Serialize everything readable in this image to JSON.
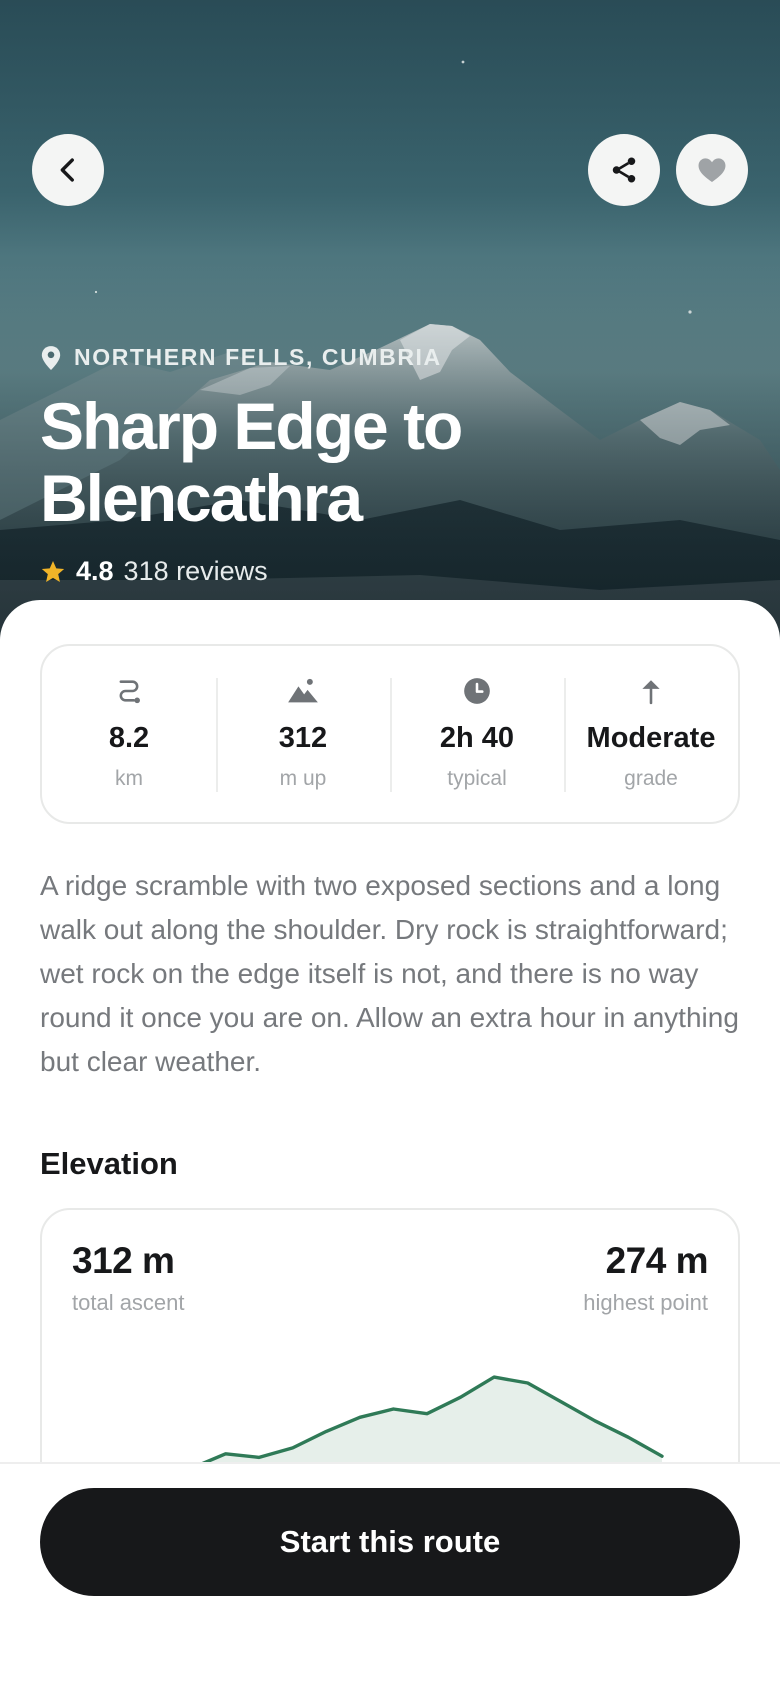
{
  "hero": {
    "location": "NORTHERN FELLS, CUMBRIA",
    "title": "Sharp Edge to Blencathra",
    "rating": "4.8",
    "reviews": "318 reviews"
  },
  "icons": {
    "back": "chevron-left-icon",
    "share": "share-icon",
    "favorite": "heart-icon",
    "location": "map-pin-icon",
    "rating": "star-icon"
  },
  "colors": {
    "accent": "#2f7a57",
    "star": "#f0b428",
    "cta": "#17181a"
  },
  "stats": [
    {
      "icon": "route-icon",
      "value": "8.2",
      "unit": "km"
    },
    {
      "icon": "mountain-icon",
      "value": "312",
      "unit": "m up"
    },
    {
      "icon": "clock-icon",
      "value": "2h 40",
      "unit": "typical"
    },
    {
      "icon": "arrow-up-icon",
      "value": "Moderate",
      "unit": "grade"
    }
  ],
  "description": "A ridge scramble with two exposed sections and a long walk out along the shoulder. Dry rock is straightforward; wet rock on the edge itself is not, and there is no way round it once you are on. Allow an extra hour in anything but clear weather.",
  "elevation": {
    "section_title": "Elevation",
    "total_ascent_value": "312 m",
    "total_ascent_label": "total ascent",
    "highest_point_value": "274 m",
    "highest_point_label": "highest point",
    "profile_relative": [
      0.0,
      0.12,
      0.09,
      0.17,
      0.31,
      0.43,
      0.5,
      0.46,
      0.6,
      0.77,
      0.72,
      0.56,
      0.4,
      0.26,
      0.1
    ]
  },
  "cta": {
    "label": "Start this route"
  }
}
